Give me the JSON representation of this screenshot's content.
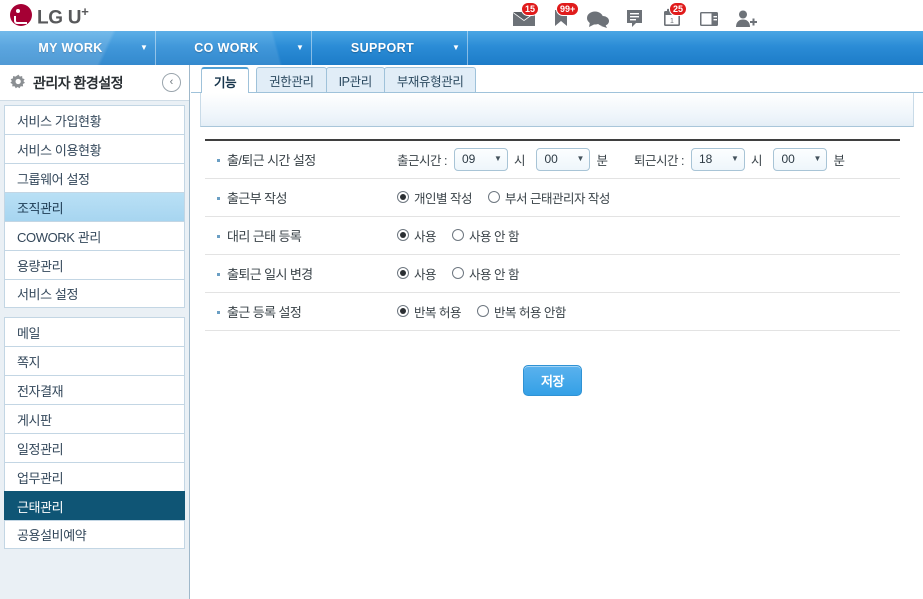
{
  "brand": {
    "name": "LG U",
    "superscript": "+",
    "logo_color": "#a50034",
    "text_color": "#58595b"
  },
  "tray": {
    "icons": [
      {
        "name": "mail-icon",
        "badge": "15"
      },
      {
        "name": "bookmark-icon",
        "badge": "99+"
      },
      {
        "name": "chat-icon",
        "badge": ""
      },
      {
        "name": "memo-icon",
        "badge": ""
      },
      {
        "name": "calendar-icon",
        "badge": "25"
      },
      {
        "name": "addressbook-icon",
        "badge": ""
      },
      {
        "name": "add-user-icon",
        "badge": ""
      }
    ]
  },
  "nav": {
    "accent": "#2b8cd6",
    "items": [
      {
        "label": "MY WORK",
        "caret": "▼"
      },
      {
        "label": "CO WORK",
        "caret": "▼"
      },
      {
        "label": "SUPPORT",
        "caret": "▼"
      }
    ]
  },
  "sidebar": {
    "title": "관리자 환경설정",
    "back_label": "‹",
    "group_a": [
      {
        "label": "서비스 가입현황",
        "state": "normal"
      },
      {
        "label": "서비스 이용현황",
        "state": "normal"
      },
      {
        "label": "그룹웨어 설정",
        "state": "normal"
      },
      {
        "label": "조직관리",
        "state": "selected-light"
      },
      {
        "label": "COWORK 관리",
        "state": "normal"
      },
      {
        "label": "용량관리",
        "state": "normal"
      },
      {
        "label": "서비스 설정",
        "state": "normal"
      }
    ],
    "group_b": [
      {
        "label": "메일",
        "state": "normal"
      },
      {
        "label": "쪽지",
        "state": "normal"
      },
      {
        "label": "전자결재",
        "state": "normal"
      },
      {
        "label": "게시판",
        "state": "normal"
      },
      {
        "label": "일정관리",
        "state": "normal"
      },
      {
        "label": "업무관리",
        "state": "normal"
      },
      {
        "label": "근태관리",
        "state": "selected-dark"
      },
      {
        "label": "공용설비예약",
        "state": "normal"
      }
    ]
  },
  "tabs": [
    {
      "label": "기능",
      "active": true
    },
    {
      "label": "권한관리",
      "active": false
    },
    {
      "label": "IP관리",
      "active": false
    },
    {
      "label": "부재유형관리",
      "active": false
    }
  ],
  "form": {
    "rows": [
      {
        "label": "출/퇴근 시간 설정",
        "type": "time",
        "start_label": "출근시간 :",
        "start_hour": "09",
        "start_hour_unit": "시",
        "start_min": "00",
        "start_min_unit": "분",
        "end_label": "퇴근시간 :",
        "end_hour": "18",
        "end_hour_unit": "시",
        "end_min": "00",
        "end_min_unit": "분"
      },
      {
        "label": "출근부 작성",
        "type": "radio",
        "options": [
          {
            "label": "개인별 작성",
            "checked": true
          },
          {
            "label": "부서 근태관리자 작성",
            "checked": false
          }
        ]
      },
      {
        "label": "대리 근태 등록",
        "type": "radio",
        "options": [
          {
            "label": "사용",
            "checked": true
          },
          {
            "label": "사용 안 함",
            "checked": false
          }
        ]
      },
      {
        "label": "출퇴근 일시 변경",
        "type": "radio",
        "options": [
          {
            "label": "사용",
            "checked": true
          },
          {
            "label": "사용 안 함",
            "checked": false
          }
        ]
      },
      {
        "label": "출근 등록 설정",
        "type": "radio",
        "options": [
          {
            "label": "반복 허용",
            "checked": true
          },
          {
            "label": "반복 허용 안함",
            "checked": false
          }
        ]
      }
    ],
    "save_label": "저장"
  }
}
